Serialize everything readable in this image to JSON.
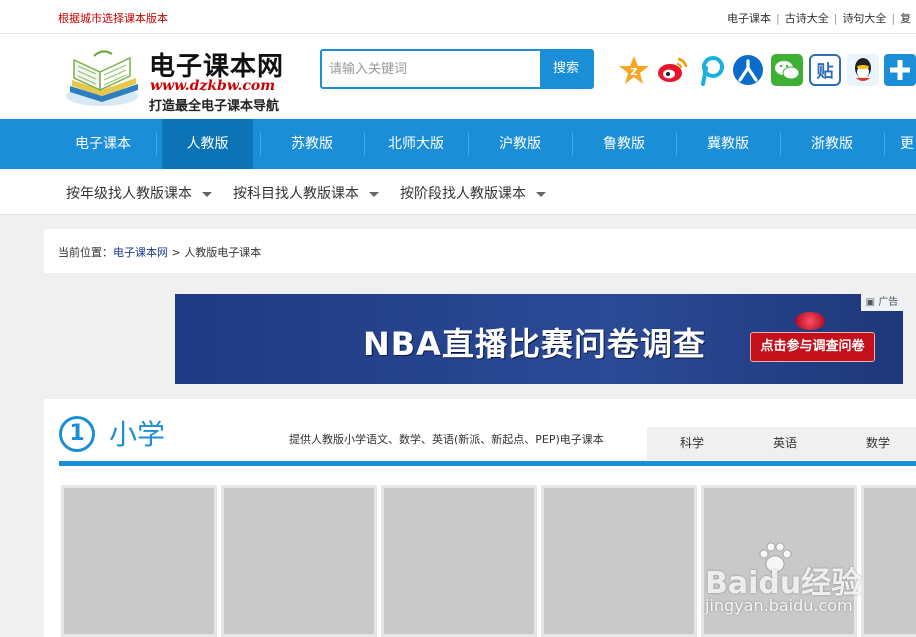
{
  "topbar": {
    "notice": "根据城市选择课本版本",
    "links": [
      "电子课本",
      "古诗大全",
      "诗句大全",
      "复"
    ]
  },
  "header": {
    "logo_name": "电子课本网",
    "logo_url": "www.dzkbw.com",
    "logo_slogan": "打造最全电子课本导航",
    "search_placeholder": "请输入关键词",
    "search_button": "搜索",
    "social_icons": [
      "qzone-icon",
      "weibo-icon",
      "pengyou-icon",
      "renren-icon",
      "wechat-icon",
      "tieba-icon",
      "qq-icon",
      "share-plus-icon"
    ]
  },
  "nav": {
    "items": [
      "电子课本",
      "人教版",
      "苏教版",
      "北师大版",
      "沪教版",
      "鲁教版",
      "冀教版",
      "浙教版",
      "更"
    ],
    "active_index": 1
  },
  "subnav": {
    "items": [
      "按年级找人教版课本",
      "按科目找人教版课本",
      "按阶段找人教版课本"
    ]
  },
  "breadcrumb": {
    "prefix": "当前位置：",
    "home": "电子课本网",
    "separator": ">",
    "current": "人教版电子课本"
  },
  "ad": {
    "headline": "NBA直播比赛问卷调查",
    "cta": "点击参与调查问卷",
    "label": "广告"
  },
  "section": {
    "number": "1",
    "title": "小学",
    "description": "提供人教版小学语文、数学、英语(新派、新起点、PEP)电子课本",
    "tabs": [
      "科学",
      "英语",
      "数学"
    ],
    "book_count": 6
  },
  "watermark": {
    "logo": "Baidu经验",
    "url": "jingyan.baidu.com"
  },
  "colors": {
    "primary": "#1a8fd8",
    "nav_active": "#0d73b7",
    "notice_red": "#c00000"
  }
}
